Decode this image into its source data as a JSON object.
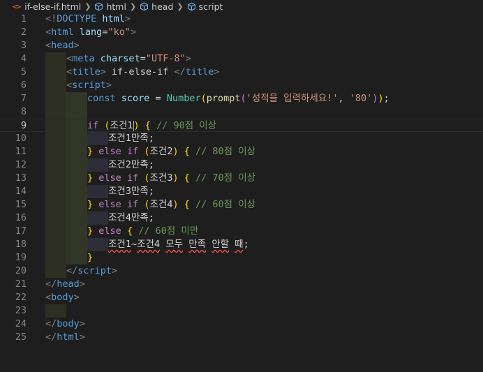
{
  "breadcrumb": {
    "file_icon": "<>",
    "file": "if-else-if.html",
    "items": [
      "html",
      "head",
      "script"
    ]
  },
  "lines": [
    {
      "n": "1",
      "indent": 0,
      "tokens": [
        [
          "t-punc",
          "<!"
        ],
        [
          "t-tag",
          "DOCTYPE"
        ],
        [
          "t-plain",
          " "
        ],
        [
          "t-attr",
          "html"
        ],
        [
          "t-punc",
          ">"
        ]
      ]
    },
    {
      "n": "2",
      "indent": 0,
      "tokens": [
        [
          "t-punc",
          "<"
        ],
        [
          "t-tag",
          "html"
        ],
        [
          "t-plain",
          " "
        ],
        [
          "t-attr",
          "lang"
        ],
        [
          "t-plain",
          "="
        ],
        [
          "t-str",
          "\"ko\""
        ],
        [
          "t-punc",
          ">"
        ]
      ]
    },
    {
      "n": "3",
      "indent": 0,
      "tokens": [
        [
          "t-punc",
          "<"
        ],
        [
          "t-tag",
          "head"
        ],
        [
          "t-punc",
          ">"
        ]
      ]
    },
    {
      "n": "4",
      "indent": 1,
      "tokens": [
        [
          "t-punc",
          "<"
        ],
        [
          "t-tag",
          "meta"
        ],
        [
          "t-plain",
          " "
        ],
        [
          "t-attr",
          "charset"
        ],
        [
          "t-plain",
          "="
        ],
        [
          "t-str",
          "\"UTF-8\""
        ],
        [
          "t-punc",
          ">"
        ]
      ]
    },
    {
      "n": "5",
      "indent": 1,
      "tokens": [
        [
          "t-punc",
          "<"
        ],
        [
          "t-tag",
          "title"
        ],
        [
          "t-punc",
          ">"
        ],
        [
          "t-plain",
          " if-else-if "
        ],
        [
          "t-punc",
          "</"
        ],
        [
          "t-tag",
          "title"
        ],
        [
          "t-punc",
          ">"
        ]
      ]
    },
    {
      "n": "6",
      "indent": 1,
      "tokens": [
        [
          "t-punc",
          "<"
        ],
        [
          "t-tag",
          "script"
        ],
        [
          "t-punc",
          ">"
        ]
      ]
    },
    {
      "n": "7",
      "indent": 2,
      "tokens": [
        [
          "t-kw",
          "const"
        ],
        [
          "t-plain",
          " "
        ],
        [
          "t-var",
          "score"
        ],
        [
          "t-plain",
          " = "
        ],
        [
          "t-cls",
          "Number"
        ],
        [
          "t-br1",
          "("
        ],
        [
          "t-fn",
          "prompt"
        ],
        [
          "t-br2",
          "("
        ],
        [
          "t-str",
          "'성적을 입력하세요!'"
        ],
        [
          "t-plain",
          ", "
        ],
        [
          "t-str",
          "'80'"
        ],
        [
          "t-br2",
          ")"
        ],
        [
          "t-br1",
          ")"
        ],
        [
          "t-plain",
          ";"
        ]
      ]
    },
    {
      "n": "8",
      "indent": 2,
      "tokens": []
    },
    {
      "n": "9",
      "indent": 2,
      "current": true,
      "tokens": [
        [
          "t-ctrl",
          "if"
        ],
        [
          "t-plain",
          " "
        ],
        [
          "t-br1",
          "("
        ],
        [
          "t-plain",
          "조건1"
        ],
        [
          "cursor",
          ""
        ],
        [
          "t-br1",
          ")"
        ],
        [
          "t-plain",
          " "
        ],
        [
          "t-br1",
          "{"
        ],
        [
          "t-plain",
          " "
        ],
        [
          "t-cmt",
          "// 90점 이상"
        ]
      ]
    },
    {
      "n": "10",
      "indent": 3,
      "tokens": [
        [
          "t-plain",
          "조건1만족;"
        ]
      ]
    },
    {
      "n": "11",
      "indent": 2,
      "tokens": [
        [
          "t-br1",
          "}"
        ],
        [
          "t-plain",
          " "
        ],
        [
          "t-ctrl",
          "else"
        ],
        [
          "t-plain",
          " "
        ],
        [
          "t-ctrl",
          "if"
        ],
        [
          "t-plain",
          " "
        ],
        [
          "t-br1",
          "("
        ],
        [
          "t-plain",
          "조건2"
        ],
        [
          "t-br1",
          ")"
        ],
        [
          "t-plain",
          " "
        ],
        [
          "t-br1",
          "{"
        ],
        [
          "t-plain",
          " "
        ],
        [
          "t-cmt",
          "// 80점 이상"
        ]
      ]
    },
    {
      "n": "12",
      "indent": 3,
      "tokens": [
        [
          "t-plain",
          "조건2만족;"
        ]
      ]
    },
    {
      "n": "13",
      "indent": 2,
      "tokens": [
        [
          "t-br1",
          "}"
        ],
        [
          "t-plain",
          " "
        ],
        [
          "t-ctrl",
          "else"
        ],
        [
          "t-plain",
          " "
        ],
        [
          "t-ctrl",
          "if"
        ],
        [
          "t-plain",
          " "
        ],
        [
          "t-br1",
          "("
        ],
        [
          "t-plain",
          "조건3"
        ],
        [
          "t-br1",
          ")"
        ],
        [
          "t-plain",
          " "
        ],
        [
          "t-br1",
          "{"
        ],
        [
          "t-plain",
          " "
        ],
        [
          "t-cmt",
          "// 70점 이상"
        ]
      ]
    },
    {
      "n": "14",
      "indent": 3,
      "tokens": [
        [
          "t-plain",
          "조건3만족;"
        ]
      ]
    },
    {
      "n": "15",
      "indent": 2,
      "tokens": [
        [
          "t-br1",
          "}"
        ],
        [
          "t-plain",
          " "
        ],
        [
          "t-ctrl",
          "else"
        ],
        [
          "t-plain",
          " "
        ],
        [
          "t-ctrl",
          "if"
        ],
        [
          "t-plain",
          " "
        ],
        [
          "t-br1",
          "("
        ],
        [
          "t-plain",
          "조건4"
        ],
        [
          "t-br1",
          ")"
        ],
        [
          "t-plain",
          " "
        ],
        [
          "t-br1",
          "{"
        ],
        [
          "t-plain",
          " "
        ],
        [
          "t-cmt",
          "// 60점 이상"
        ]
      ]
    },
    {
      "n": "16",
      "indent": 3,
      "tokens": [
        [
          "t-plain",
          "조건4만족;"
        ]
      ]
    },
    {
      "n": "17",
      "indent": 2,
      "tokens": [
        [
          "t-br1",
          "}"
        ],
        [
          "t-plain",
          " "
        ],
        [
          "t-ctrl",
          "else"
        ],
        [
          "t-plain",
          " "
        ],
        [
          "t-br1",
          "{"
        ],
        [
          "t-plain",
          " "
        ],
        [
          "t-cmt",
          "// 60점 미만"
        ]
      ]
    },
    {
      "n": "18",
      "indent": 3,
      "tokens": [
        [
          "t-plain squiggle",
          "조건1"
        ],
        [
          "t-plain",
          "~"
        ],
        [
          "t-plain squiggle",
          "조건4"
        ],
        [
          "t-plain",
          " "
        ],
        [
          "t-plain squiggle",
          "모두"
        ],
        [
          "t-plain",
          " "
        ],
        [
          "t-plain squiggle",
          "만족"
        ],
        [
          "t-plain",
          " "
        ],
        [
          "t-plain squiggle",
          "안할"
        ],
        [
          "t-plain",
          " "
        ],
        [
          "t-plain squiggle",
          "때"
        ],
        [
          "t-plain",
          ";"
        ]
      ]
    },
    {
      "n": "19",
      "indent": 2,
      "tokens": [
        [
          "t-br1",
          "}"
        ]
      ]
    },
    {
      "n": "20",
      "indent": 1,
      "tokens": [
        [
          "t-punc",
          "</"
        ],
        [
          "t-tag",
          "script"
        ],
        [
          "t-punc",
          ">"
        ]
      ]
    },
    {
      "n": "21",
      "indent": 0,
      "tokens": [
        [
          "t-punc",
          "</"
        ],
        [
          "t-tag",
          "head"
        ],
        [
          "t-punc",
          ">"
        ]
      ]
    },
    {
      "n": "22",
      "indent": 0,
      "tokens": [
        [
          "t-punc",
          "<"
        ],
        [
          "t-tag",
          "body"
        ],
        [
          "t-punc",
          ">"
        ]
      ]
    },
    {
      "n": "23",
      "indent": 1,
      "tokens": []
    },
    {
      "n": "24",
      "indent": 0,
      "tokens": [
        [
          "t-punc",
          "</"
        ],
        [
          "t-tag",
          "body"
        ],
        [
          "t-punc",
          ">"
        ]
      ]
    },
    {
      "n": "25",
      "indent": 0,
      "tokens": [
        [
          "t-punc",
          "</"
        ],
        [
          "t-tag",
          "html"
        ],
        [
          "t-punc",
          ">"
        ]
      ]
    }
  ],
  "colors": {
    "background": "#1e1e1e",
    "tag": "#569cd6",
    "string": "#ce9178",
    "comment": "#6a9955",
    "control": "#c586c0"
  }
}
